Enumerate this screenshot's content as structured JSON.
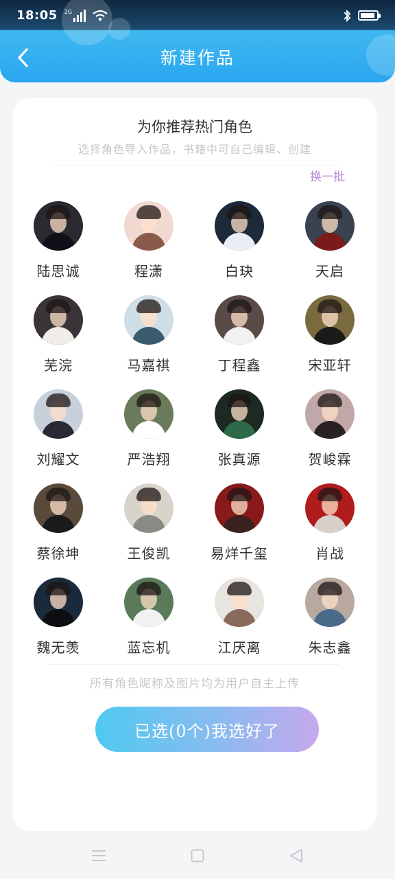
{
  "status_bar": {
    "time": "18:05",
    "network": "2G",
    "icons": [
      "signal-icon",
      "wifi-icon",
      "bluetooth-icon",
      "battery-icon"
    ],
    "battery_level": 0.9
  },
  "header": {
    "title": "新建作品",
    "back_icon": "chevron-left-icon"
  },
  "card": {
    "headline": "为你推荐热门角色",
    "subline": "选择角色导入作品，书籍中可自己编辑、创建",
    "refresh_label": "换一批",
    "characters": [
      {
        "name": "陆思诚",
        "bg": "#2a2a30",
        "body": "#101018"
      },
      {
        "name": "程潇",
        "bg": "#f0d9d0",
        "body": "#8a5a4a"
      },
      {
        "name": "白玦",
        "bg": "#1c2a3a",
        "body": "#e8eef4"
      },
      {
        "name": "天启",
        "bg": "#3a4250",
        "body": "#7a1a1a"
      },
      {
        "name": "芜浣",
        "bg": "#3a3438",
        "body": "#f1ede8"
      },
      {
        "name": "马嘉祺",
        "bg": "#cfdde6",
        "body": "#3a5a70"
      },
      {
        "name": "丁程鑫",
        "bg": "#5a4a48",
        "body": "#f2f0f0"
      },
      {
        "name": "宋亚轩",
        "bg": "#7a6a40",
        "body": "#1a1a1a"
      },
      {
        "name": "刘耀文",
        "bg": "#c8d0dc",
        "body": "#2a2a34"
      },
      {
        "name": "严浩翔",
        "bg": "#6a7a5a",
        "body": "#ffffff"
      },
      {
        "name": "张真源",
        "bg": "#1c2a22",
        "body": "#2c6a4a"
      },
      {
        "name": "贺峻霖",
        "bg": "#c0a8a8",
        "body": "#2a2222"
      },
      {
        "name": "蔡徐坤",
        "bg": "#5a4a3c",
        "body": "#1a1a1a"
      },
      {
        "name": "王俊凯",
        "bg": "#d8d4cc",
        "body": "#8a8a84"
      },
      {
        "name": "易烊千玺",
        "bg": "#8a1a1a",
        "body": "#3a2220"
      },
      {
        "name": "肖战",
        "bg": "#b01c1c",
        "body": "#d8d0c8"
      },
      {
        "name": "魏无羡",
        "bg": "#1a2a3a",
        "body": "#0e0e12"
      },
      {
        "name": "蓝忘机",
        "bg": "#5a7a5a",
        "body": "#f2f2f2"
      },
      {
        "name": "江厌离",
        "bg": "#e8e4e0",
        "body": "#8a6a5a"
      },
      {
        "name": "朱志鑫",
        "bg": "#b8a8a0",
        "body": "#4a6a8a"
      }
    ],
    "notice": "所有角色昵称及图片均为用户自主上传",
    "submit_label": "已选(0个)我选好了"
  },
  "nav": {
    "icons": [
      "menu-icon",
      "home-square-icon",
      "back-triangle-icon"
    ]
  },
  "colors": {
    "accent_blue": "#2aa6f0",
    "refresh_purple": "#b58ad8",
    "button_gradient_start": "#4fc9f0",
    "button_gradient_end": "#c6a8ec"
  }
}
